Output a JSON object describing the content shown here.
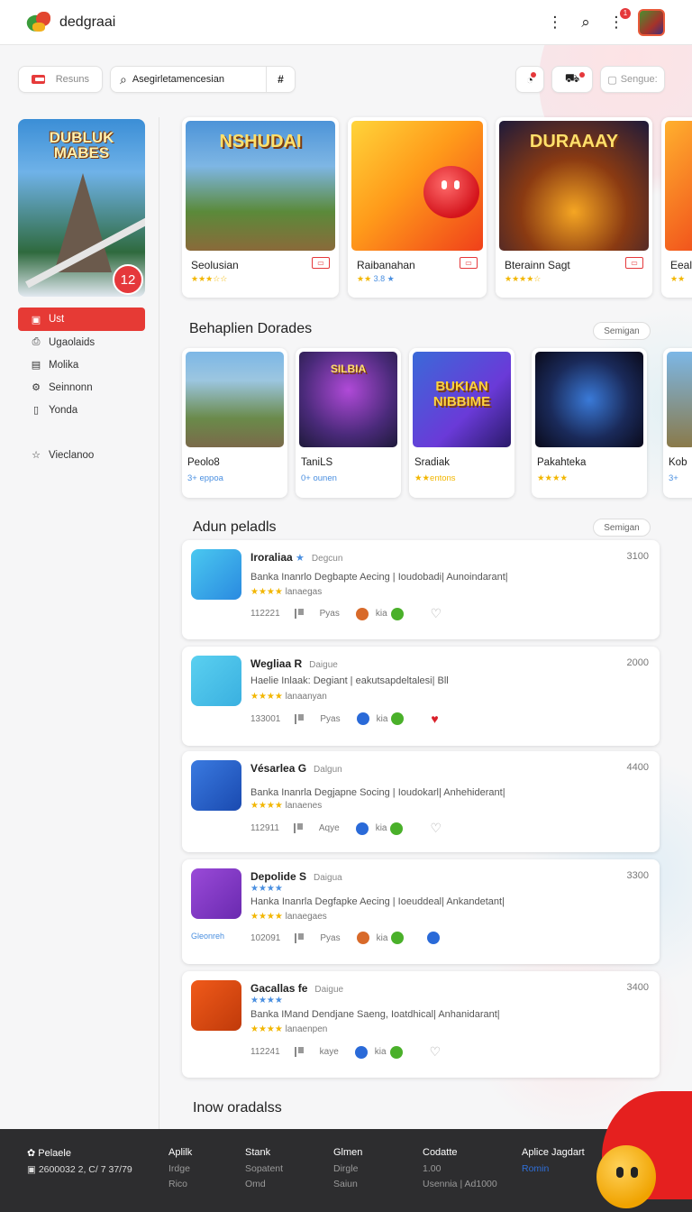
{
  "header": {
    "brand": "dedgraai",
    "notif_count": "1"
  },
  "toolbar": {
    "resource_label": "Resuns",
    "search_value": "Asegirletamencesian",
    "hash_label": "#",
    "sign_label": "Sengue:"
  },
  "sidebar": {
    "feature": {
      "title_line1": "DUBLUK",
      "title_line2": "MABES",
      "badge": "12"
    },
    "nav": [
      {
        "label": "Ust",
        "icon": "grid-icon",
        "active": true
      },
      {
        "label": "Ugaolaids",
        "icon": "download-icon"
      },
      {
        "label": "Molika",
        "icon": "book-icon"
      },
      {
        "label": "Seinnonn",
        "icon": "gear-icon"
      },
      {
        "label": "Yonda",
        "icon": "document-icon"
      },
      {
        "label": "Vieclanoo",
        "icon": "star-icon"
      }
    ]
  },
  "featured": [
    {
      "title": "Seolusian",
      "art": "NSHUDAI",
      "tag": "▭",
      "stars": "★★★☆☆",
      "extra": ""
    },
    {
      "title": "Raibanahan",
      "art": "",
      "tag": "▭",
      "stars": "★★",
      "extra": "3.8 ★"
    },
    {
      "title": "Bterainn Sagt",
      "art": "DURAAAY",
      "tag": "▭",
      "stars": "★★★★☆",
      "extra": ""
    },
    {
      "title": "Eeal",
      "art": "",
      "tag": "",
      "stars": "★★",
      "extra": ""
    }
  ],
  "section1": {
    "title": "Behaplien Dorades",
    "button": "Semigan"
  },
  "small_cards": [
    {
      "title": "Peolo8",
      "sub": "3+ eppoa"
    },
    {
      "title": "TaniLS",
      "sub": "0+ ounen"
    },
    {
      "title": "Sradiak",
      "sub": "★★entons"
    },
    {
      "title": "Pakahteka",
      "sub": "★★★★"
    },
    {
      "title": "Kob",
      "sub": "3+"
    }
  ],
  "small_art": {
    "card2": "SILBIA",
    "card3": "BUKIAN NIBBIME"
  },
  "section2": {
    "title": "Adun peladls",
    "button": "Semigan"
  },
  "list": [
    {
      "name": "Iroraliaa",
      "star": "★",
      "cat": "Degcun",
      "count": "3100",
      "desc": "Banka Inanrlo Degbapte Aecing | Ioudobadi| Aunoindarant|",
      "rating": "lanaegas",
      "stars": "★★★★",
      "date": "112221",
      "m1": "Pyas",
      "m2": "kia",
      "liked": false,
      "extra": ""
    },
    {
      "name": "Wegliaa R",
      "star": "",
      "cat": "Daigue",
      "count": "2000",
      "desc": "Haelie Inlaak: Degiant | eakutsapdeltalesi| Bll",
      "rating": "lanaanyan",
      "stars": "★★★★",
      "date": "133001",
      "m1": "Pyas",
      "m2": "kia",
      "liked": true,
      "extra": ""
    },
    {
      "name": "Vésarlea G",
      "star": "",
      "cat": "Dalgun",
      "count": "4400",
      "desc": "Banka Inanrla Degjapne Socing | Ioudokarl| Anhehiderant|",
      "rating": "lanaenes",
      "stars": "★★★★",
      "date": "112911",
      "m1": "Aqye",
      "m2": "kia",
      "liked": false,
      "extra": ""
    },
    {
      "name": "Depolide S",
      "star": "",
      "cat": "Daigua",
      "count": "3300",
      "desc": "Hanka Inanrla Degfapke Aecing | Ioeuddeal| Ankandetant|",
      "rating": "lanaegaes",
      "stars": "★★★★",
      "date": "102091",
      "m1": "Pyas",
      "m2": "kia",
      "liked": false,
      "extra": "Gleonreh",
      "top_stars": "★★★★"
    },
    {
      "name": "Gacallas fe",
      "star": "",
      "cat": "Daigue",
      "count": "3400",
      "desc": "Banka IMand Dendjane Saeng, Ioatdhical| Anhanidarant|",
      "rating": "lanaenpen",
      "stars": "★★★★",
      "date": "112241",
      "m1": "kaye",
      "m2": "kia",
      "liked": false,
      "extra": "",
      "top_stars": "★★★★"
    }
  ],
  "section3": {
    "title": "Inow oradalss"
  },
  "footer": {
    "col1": {
      "h": "Pelaele",
      "l1": "2600032 2, C/ 7 37/79"
    },
    "col2": {
      "h": "Aplilk",
      "l1": "Irdge",
      "l2": "Rico"
    },
    "col3": {
      "h": "Stank",
      "l1": "Sopatent",
      "l2": "Omd"
    },
    "col4": {
      "h": "Glmen",
      "l1": "Dirgle",
      "l2": "Saiun"
    },
    "col5": {
      "h": "Codatte",
      "l1": "1.00",
      "l2": "Usennia | Ad1000"
    },
    "col6": {
      "h": "Aplice Jagdart",
      "l1": "Romin"
    }
  },
  "colors": {
    "accent": "#e63a35",
    "star": "#f2b600",
    "link": "#4a8fe0"
  }
}
